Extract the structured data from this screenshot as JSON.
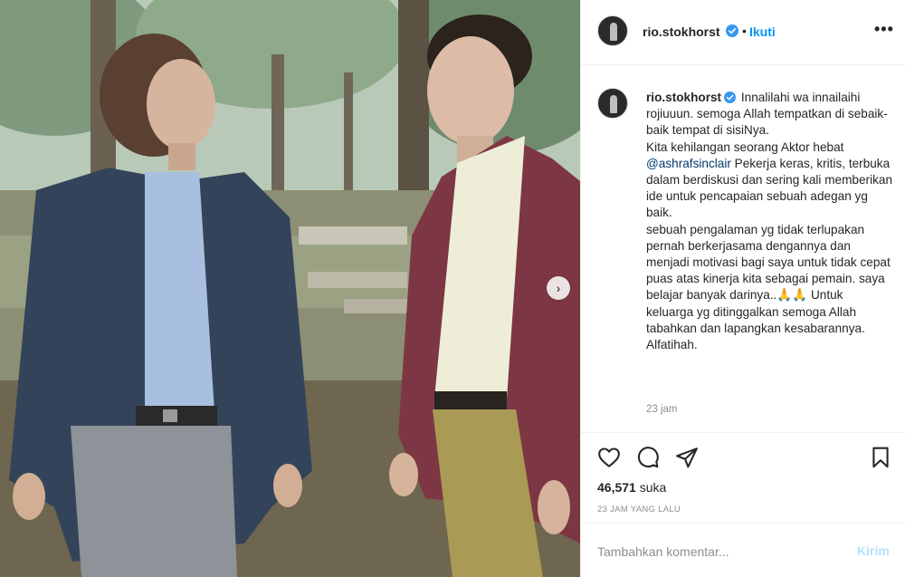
{
  "post": {
    "username": "rio.stokhorst",
    "verified": true,
    "follow_label": "Ikuti",
    "more_icon": "ellipsis-icon",
    "next_icon": "chevron-right-icon"
  },
  "caption": {
    "username": "rio.stokhorst",
    "text_1": "Innalilahi wa innailaihi rojiuuun. semoga Allah tempatkan di sebaik-baik tempat di sisiNya.",
    "text_2": "Kita kehilangan seorang Aktor hebat",
    "mention": "@ashrafsinclair",
    "text_3": "Pekerja keras, kritis, terbuka dalam berdiskusi dan sering kali memberikan ide untuk pencapaian sebuah adegan yg baik.",
    "text_4": "sebuah pengalaman yg tidak terlupakan pernah berkerjasama dengannya dan menjadi motivasi bagi saya untuk tidak cepat puas atas kinerja kita sebagai pemain. saya belajar banyak darinya..🙏🙏 Untuk keluarga yg ditinggalkan semoga Allah tabahkan dan lapangkan kesabarannya.",
    "text_5": "Alfatihah.",
    "time": "23 jam"
  },
  "actions": {
    "like_icon": "heart-icon",
    "comment_icon": "comment-icon",
    "share_icon": "paper-plane-icon",
    "save_icon": "bookmark-icon",
    "likes_count": "46,571",
    "likes_label": "suka",
    "posted_ago": "23 JAM YANG LALU"
  },
  "comment": {
    "placeholder": "Tambahkan komentar...",
    "post_label": "Kirim"
  },
  "colors": {
    "accent": "#0095f6",
    "post_disabled": "#b2dffc",
    "mention": "#00376b",
    "muted": "#8e8e8e"
  }
}
